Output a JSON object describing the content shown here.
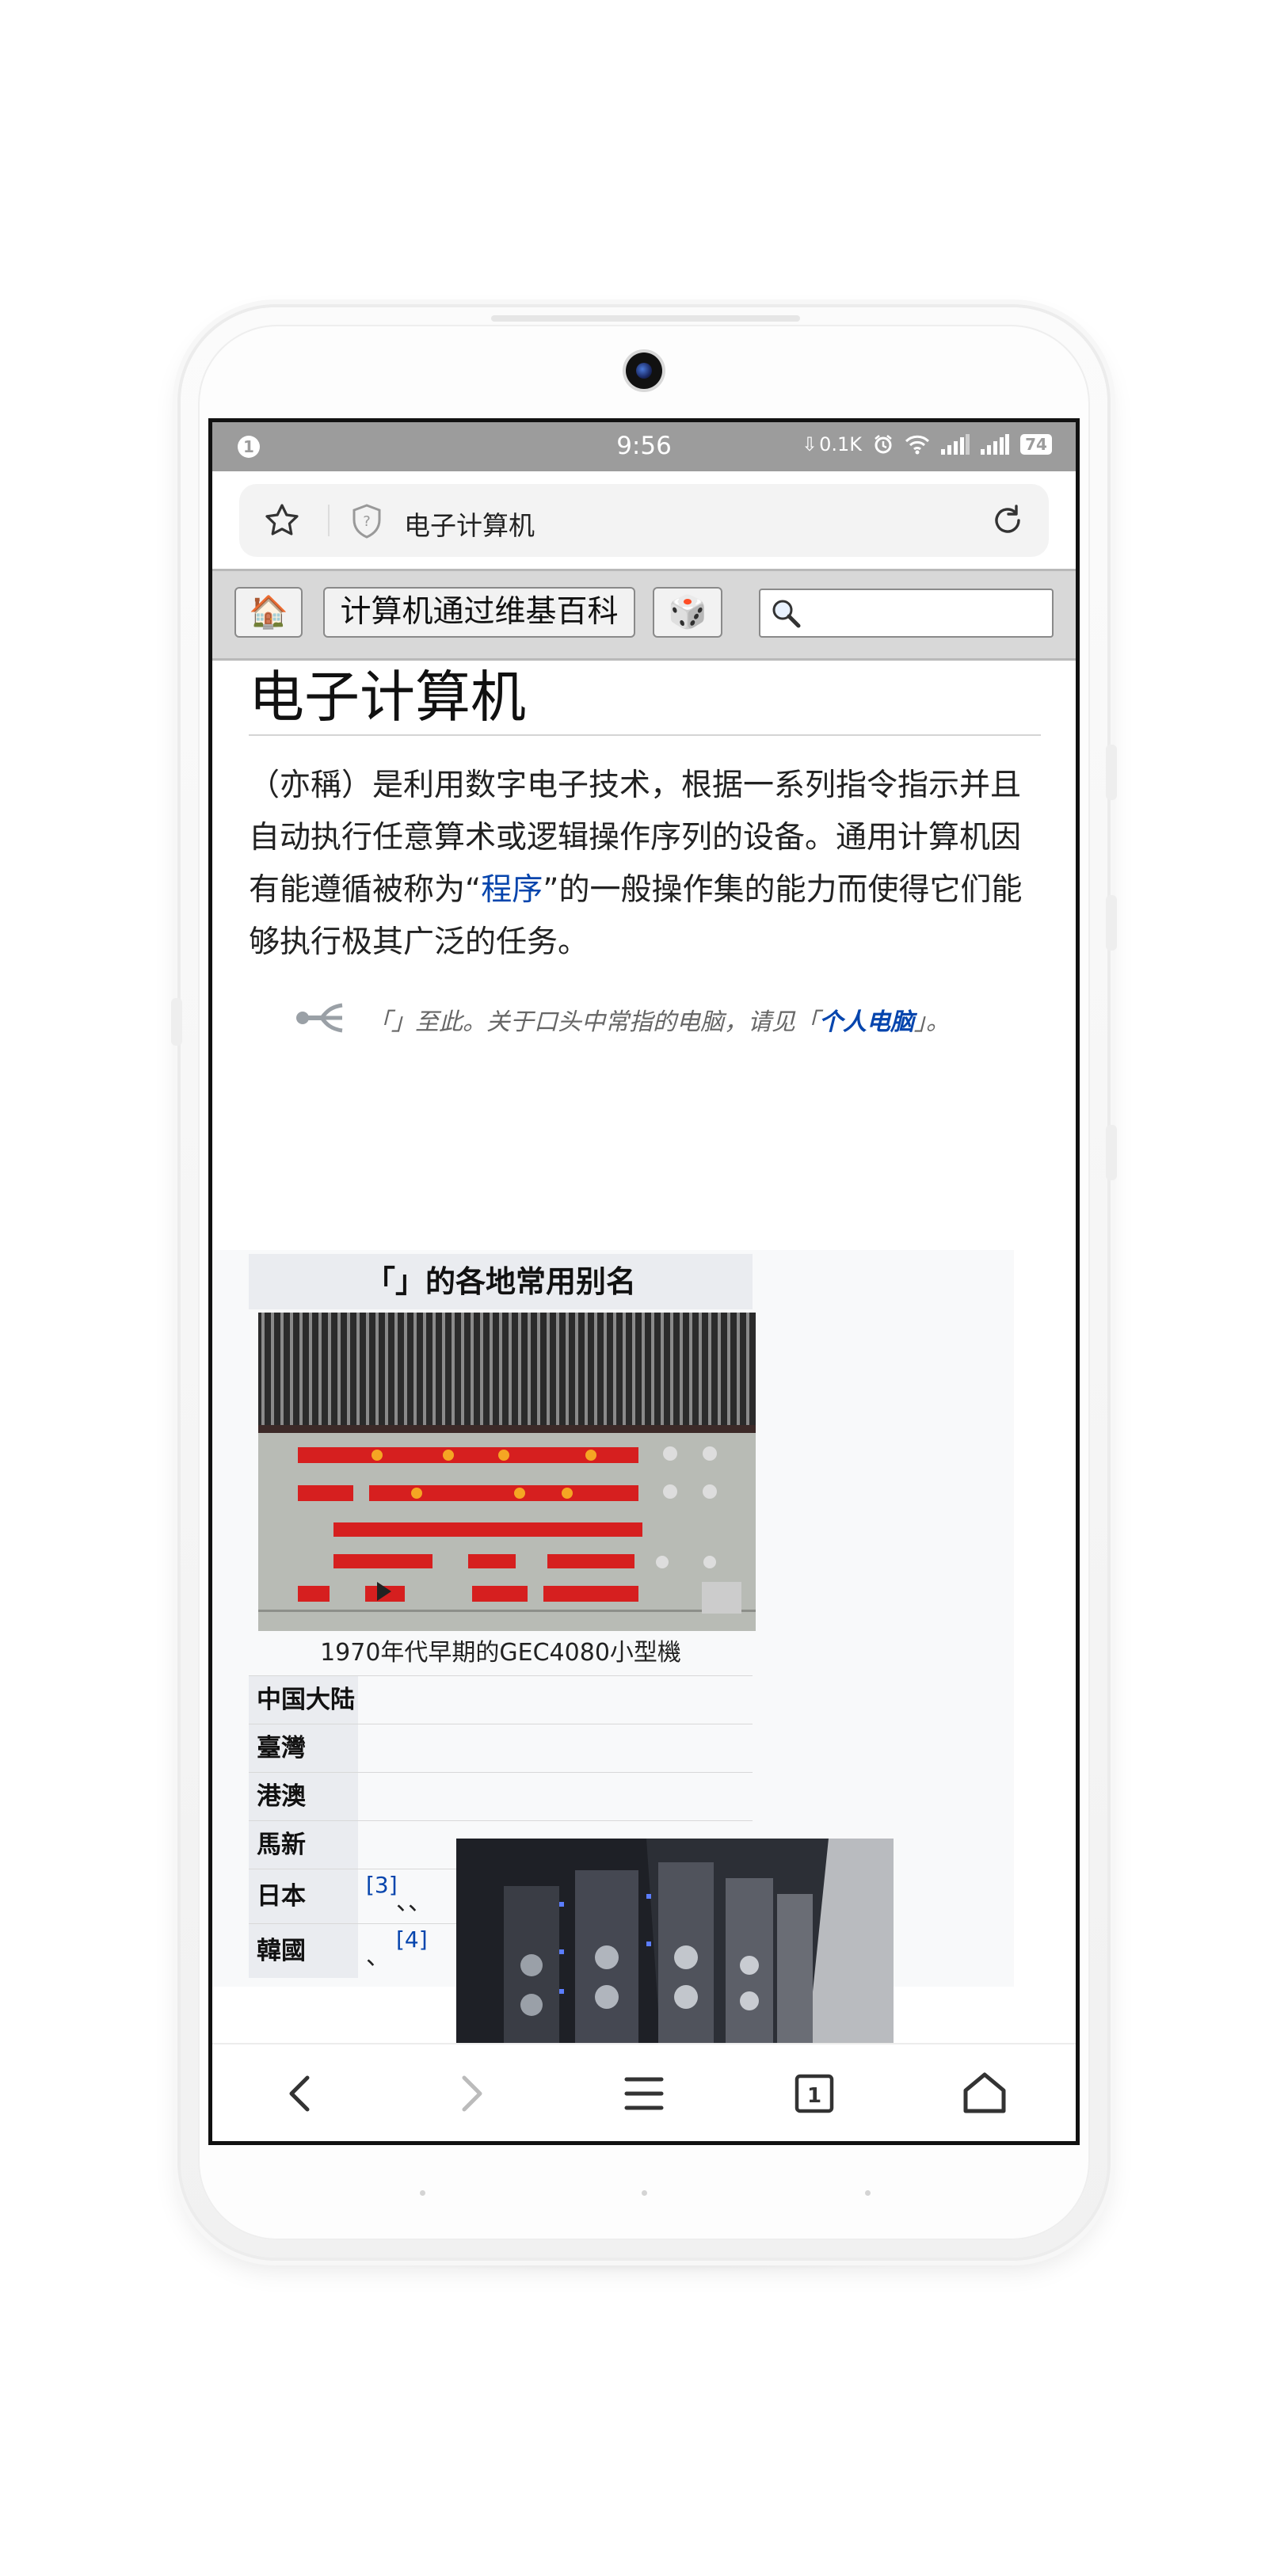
{
  "status_bar": {
    "notification_count": "1",
    "time": "9:56",
    "net_speed": "0.1K",
    "battery": "74"
  },
  "address_bar": {
    "title": "电子计算机"
  },
  "site_header": {
    "home_emoji": "🏠",
    "site_title": "计算机通过维基百科",
    "random_emoji": "🎲",
    "search_placeholder": ""
  },
  "article": {
    "title": "电子计算机",
    "lead_pre": "（亦稱）是利用数字电子技术，根据一系列指令指示并且自动执行任意算术或逻辑操作序列的设备。通用计算机因有能遵循被称为“",
    "lead_link": "程序",
    "lead_post": "”的一般操作集的能力而使得它们能够执行极其广泛的任务。",
    "hatnote_pre": "「」至此。关于口头中常指的电脑，请见「",
    "hatnote_link": "个人电脑",
    "hatnote_post": "」。"
  },
  "infobox": {
    "caption": "「」的各地常用别名",
    "image_caption": "1970年代早期的GEC4080小型機",
    "rows": [
      {
        "label": "中国大陆",
        "value": ""
      },
      {
        "label": "臺灣",
        "value": ""
      },
      {
        "label": "港澳",
        "value": ""
      },
      {
        "label": "馬新",
        "value": ""
      },
      {
        "label": "日本",
        "ref": "[3]",
        "value": "、、"
      },
      {
        "label": "韓國",
        "value": "、",
        "ref": "[4]"
      }
    ]
  },
  "colors": {
    "link": "#0645ad",
    "status_bar": "#9c9c9c",
    "infobox_header": "#eaecf0"
  }
}
